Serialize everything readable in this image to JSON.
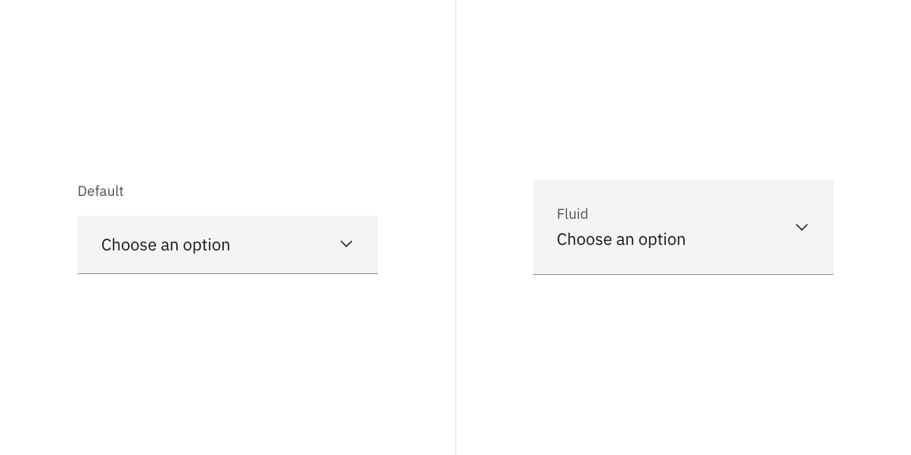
{
  "left": {
    "label": "Default",
    "dropdown_text": "Choose an option"
  },
  "right": {
    "label": "Fluid",
    "dropdown_text": "Choose an option"
  }
}
